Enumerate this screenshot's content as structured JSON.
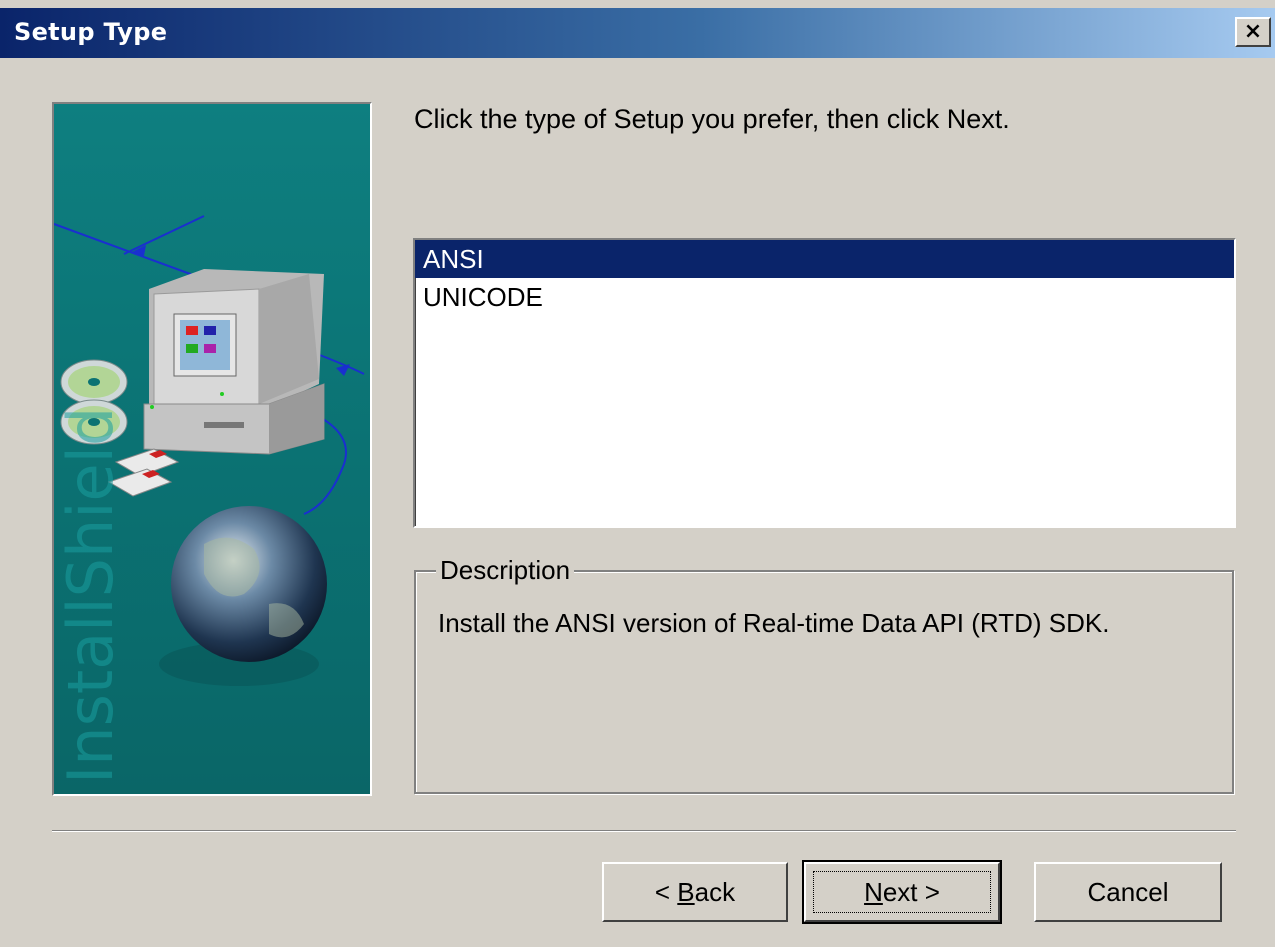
{
  "window": {
    "title": "Setup Type",
    "close_glyph": "×"
  },
  "hero": {
    "watermark": "InstallShield",
    "icons": [
      "computer-icon",
      "cd-disc-icon",
      "floppy-disk-icon",
      "globe-icon"
    ]
  },
  "instruction": "Click the type of Setup you prefer, then click Next.",
  "setup_types": {
    "items": [
      {
        "label": "ANSI",
        "selected": true
      },
      {
        "label": "UNICODE",
        "selected": false
      }
    ]
  },
  "description": {
    "group_label": "Description",
    "text": "Install the ANSI version of Real-time Data API (RTD) SDK."
  },
  "buttons": {
    "back_prefix": "< ",
    "back_accel": "B",
    "back_rest": "ack",
    "next_accel": "N",
    "next_rest": "ext >",
    "cancel": "Cancel"
  },
  "colors": {
    "title_gradient_start": "#0a246a",
    "title_gradient_end": "#a6caf0",
    "selection": "#0a246a",
    "dialog_face": "#d4d0c8",
    "hero_teal": "#0e7f80"
  }
}
